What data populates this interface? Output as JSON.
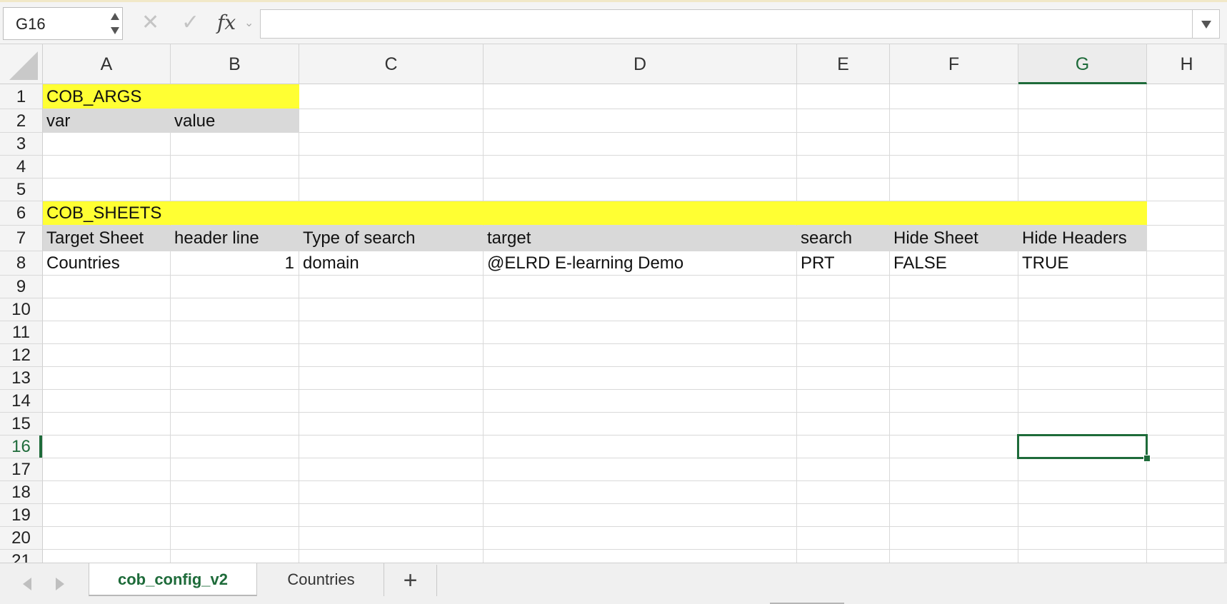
{
  "formula_bar": {
    "name_box": "G16",
    "cancel_icon": "close-icon",
    "confirm_icon": "check-icon",
    "fx_label": "fx",
    "formula_value": ""
  },
  "columns": [
    "A",
    "B",
    "C",
    "D",
    "E",
    "F",
    "G",
    "H"
  ],
  "active_column": "G",
  "rows": [
    "1",
    "2",
    "3",
    "4",
    "5",
    "6",
    "7",
    "8",
    "9",
    "10",
    "11",
    "12",
    "13",
    "14",
    "15",
    "16",
    "17",
    "18",
    "19",
    "20",
    "21"
  ],
  "active_row": "16",
  "cells": {
    "A1": "COB_ARGS",
    "A2": "var",
    "B2": "value",
    "A6": "COB_SHEETS",
    "A7": "Target Sheet",
    "B7": "header line",
    "C7": "Type of search",
    "D7": "target",
    "E7": "search",
    "F7": "Hide Sheet",
    "G7": "Hide Headers",
    "A8": "Countries",
    "B8": "1",
    "C8": "domain",
    "D8": "@ELRD E-learning Demo",
    "E8": "PRT",
    "F8": "FALSE",
    "G8": "TRUE"
  },
  "colors": {
    "section_highlight": "#ffff33",
    "header_highlight": "#d9d9d9",
    "selection": "#1e6b3a"
  },
  "sheet_tabs": [
    {
      "label": "cob_config_v2",
      "active": true
    },
    {
      "label": "Countries",
      "active": false
    }
  ],
  "add_sheet_label": "+"
}
